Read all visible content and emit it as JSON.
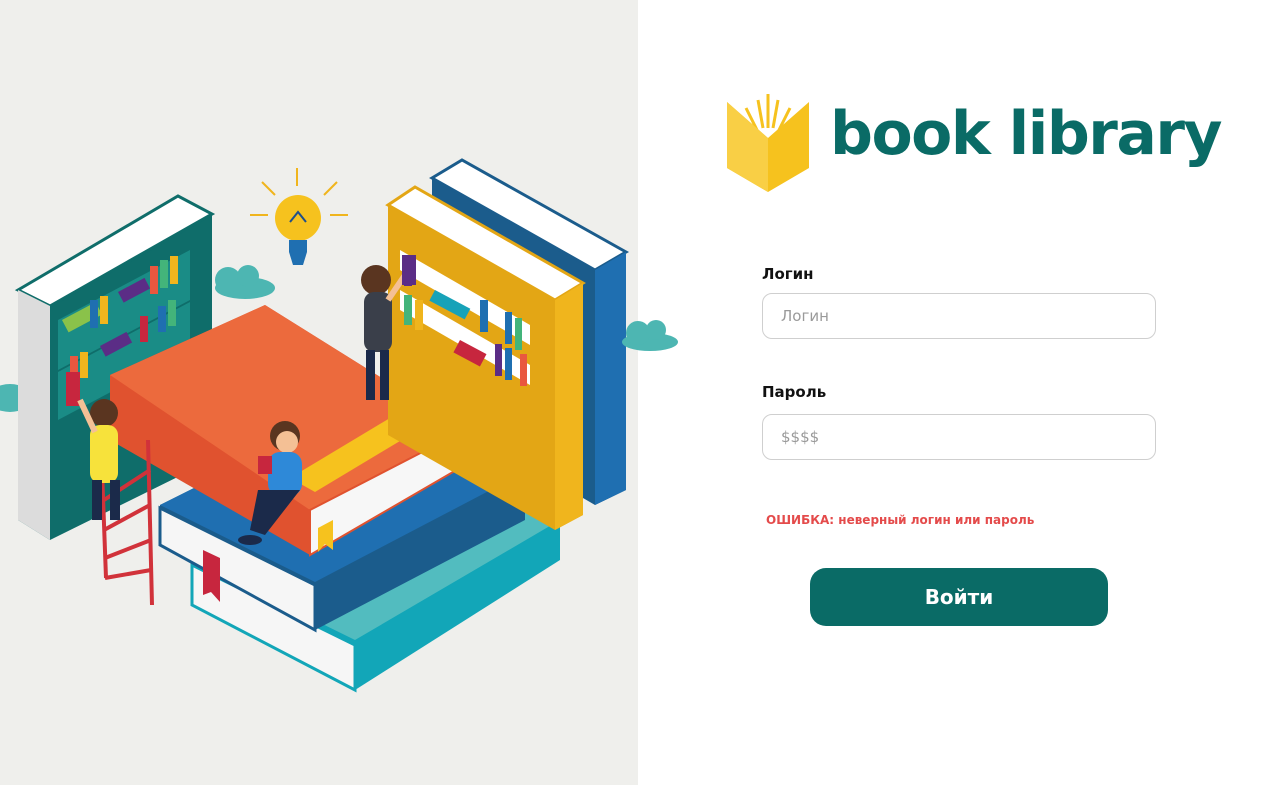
{
  "brand": {
    "name": "book library",
    "accent_color": "#0a6b66",
    "logo_icon": "open-book-icon"
  },
  "form": {
    "login": {
      "label": "Логин",
      "placeholder": "Логин",
      "value": ""
    },
    "password": {
      "label": "Пароль",
      "placeholder": "$$$$",
      "value": ""
    },
    "error": "ОШИБКА: неверный логин или пароль",
    "submit_label": "Войти"
  },
  "illustration": {
    "name": "library-illustration"
  }
}
